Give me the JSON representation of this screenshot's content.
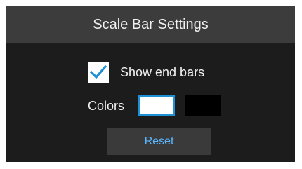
{
  "dialog": {
    "title": "Scale Bar Settings"
  },
  "end_bars": {
    "label": "Show end bars",
    "checked": true
  },
  "colors": {
    "label": "Colors",
    "options": [
      {
        "name": "white",
        "value": "#ffffff",
        "selected": true
      },
      {
        "name": "black",
        "value": "#000000",
        "selected": false
      }
    ],
    "selection_outline": "#1e90d8"
  },
  "reset_button": {
    "label": "Reset",
    "color": "#5bb8ff"
  },
  "icons": {
    "checkbox_checkmark": "checkmark-icon",
    "checkmark_color": "#1e90d8"
  }
}
